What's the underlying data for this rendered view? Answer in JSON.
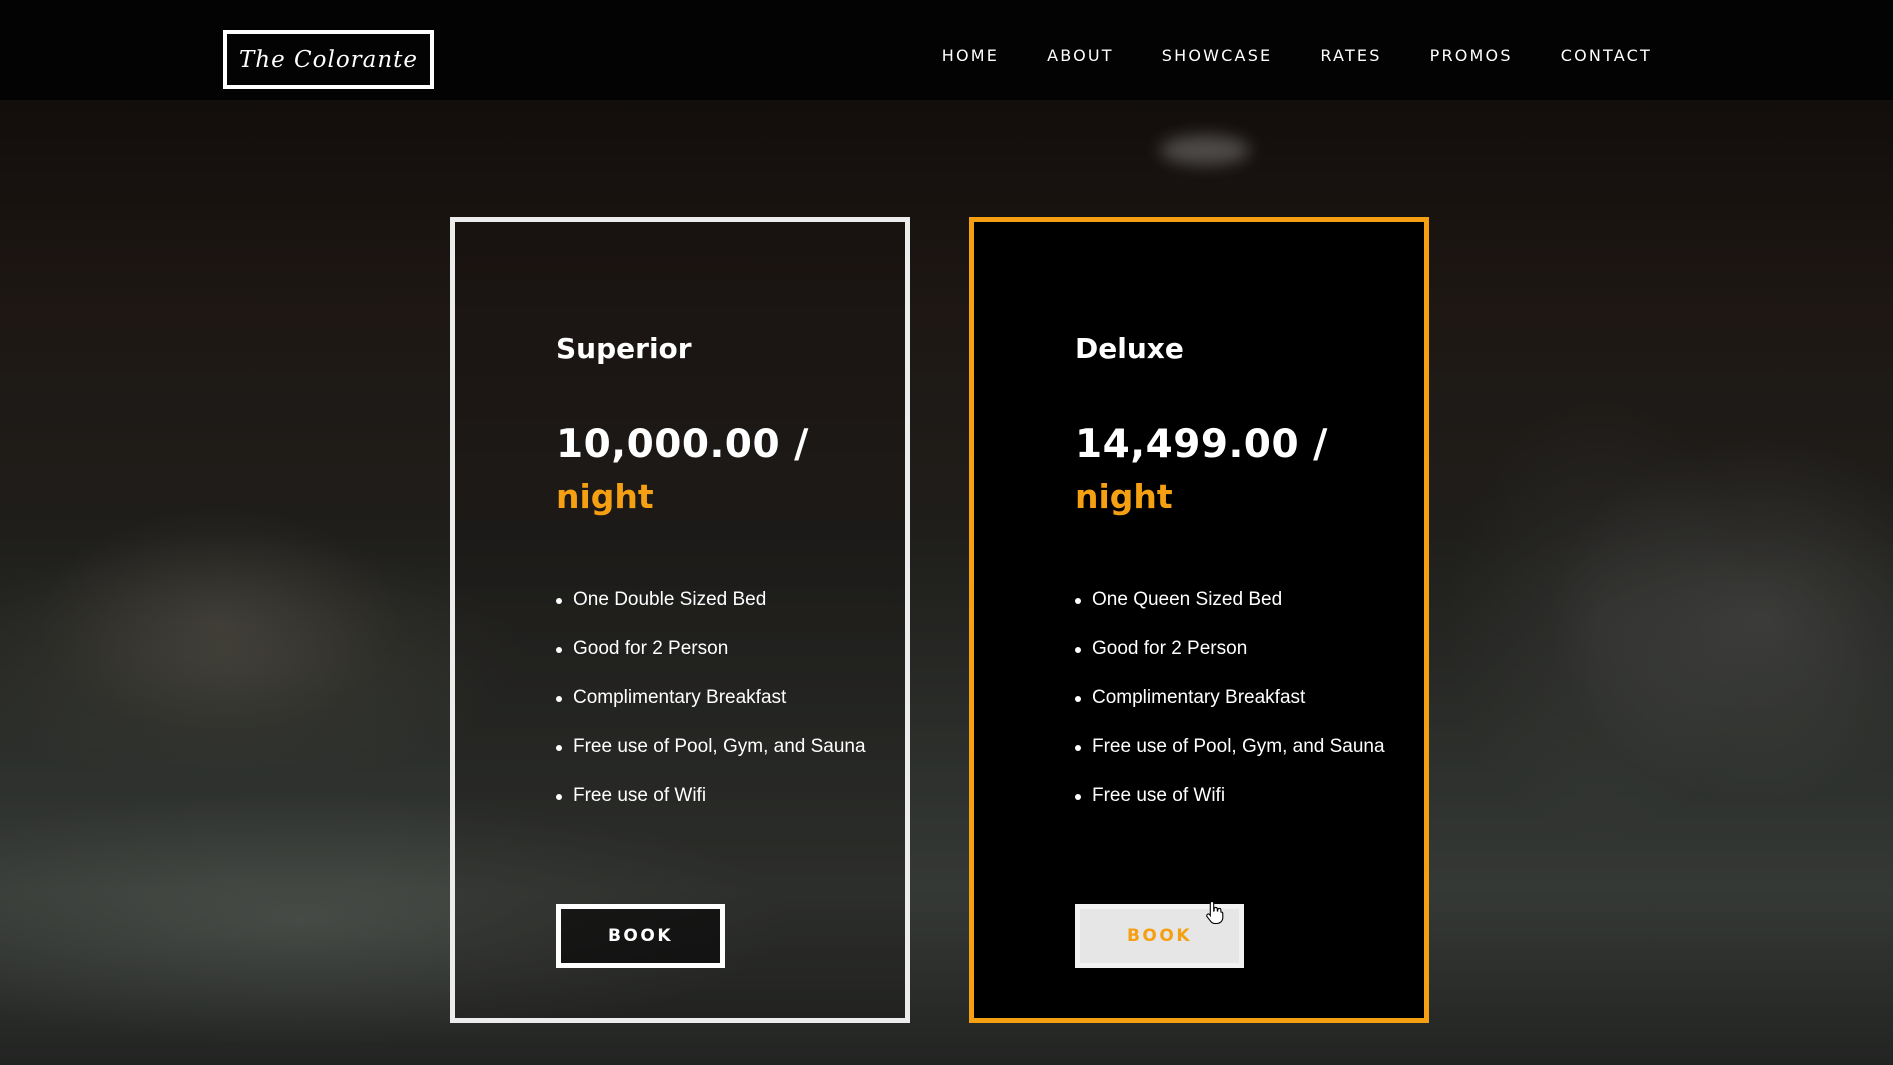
{
  "brand": {
    "logo_text": "The Colorante"
  },
  "nav": {
    "items": [
      {
        "id": "home",
        "label": "HOME"
      },
      {
        "id": "about",
        "label": "ABOUT"
      },
      {
        "id": "showcase",
        "label": "SHOWCASE"
      },
      {
        "id": "rates",
        "label": "RATES"
      },
      {
        "id": "promos",
        "label": "PROMOS"
      },
      {
        "id": "contact",
        "label": "CONTACT"
      }
    ]
  },
  "rates": {
    "cards": [
      {
        "title": "Superior",
        "price": "10,000.00 /",
        "unit": "night",
        "features": [
          "One Double Sized Bed",
          "Good for 2 Person",
          "Complimentary Breakfast",
          "Free use of Pool, Gym, and Sauna",
          "Free use of Wifi"
        ],
        "button_label": "BOOK"
      },
      {
        "title": "Deluxe",
        "price": "14,499.00 /",
        "unit": "night",
        "features": [
          "One Queen Sized Bed",
          "Good for 2 Person",
          "Complimentary Breakfast",
          "Free use of Pool, Gym, and Sauna",
          "Free use of Wifi"
        ],
        "button_label": "BOOK"
      }
    ]
  },
  "colors": {
    "accent": "#f59f12",
    "navbar_bg": "#030303",
    "text": "#ffffff"
  },
  "icons": {
    "cursor": "hand-pointer-icon"
  }
}
